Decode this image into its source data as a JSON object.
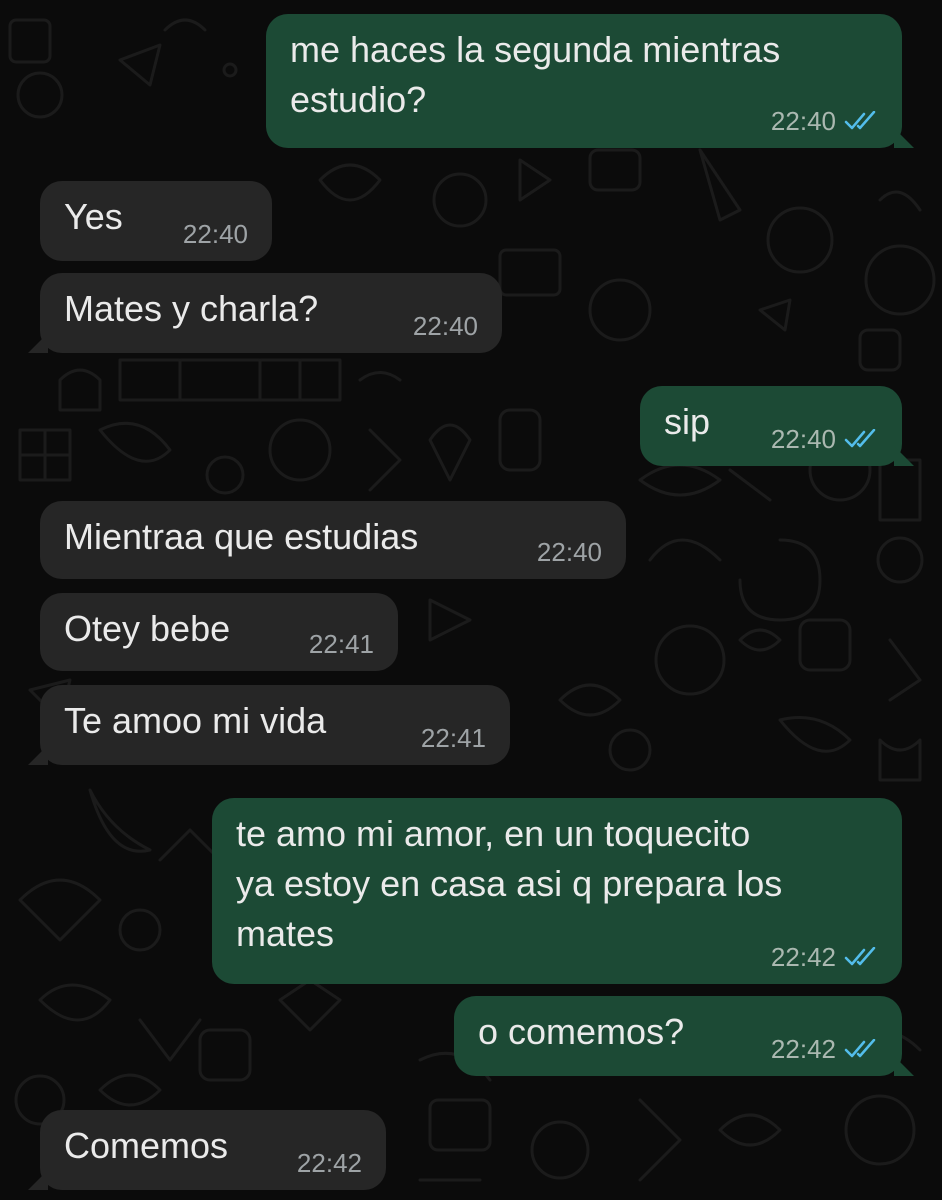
{
  "chat": {
    "background_pattern": "whatsapp-doodle-dark",
    "colors": {
      "incoming_bubble": "#262626",
      "outgoing_bubble": "#1c4a35",
      "read_ticks": "#53bdeb"
    },
    "messages": [
      {
        "direction": "out",
        "text": "me haces la segunda mientras\nestudio?",
        "time": "22:40",
        "status": "read"
      },
      {
        "direction": "in",
        "text": "Yes",
        "time": "22:40"
      },
      {
        "direction": "in",
        "text": "Mates y charla?",
        "time": "22:40"
      },
      {
        "direction": "out",
        "text": "sip",
        "time": "22:40",
        "status": "read"
      },
      {
        "direction": "in",
        "text": "Mientraa que estudias",
        "time": "22:40"
      },
      {
        "direction": "in",
        "text": "Otey bebe",
        "time": "22:41"
      },
      {
        "direction": "in",
        "text": "Te amoo mi vida",
        "time": "22:41"
      },
      {
        "direction": "out",
        "text": "te amo mi amor, en un toquecito\nya estoy en casa asi q prepara los\nmates",
        "time": "22:42",
        "status": "read"
      },
      {
        "direction": "out",
        "text": "o comemos?",
        "time": "22:42",
        "status": "read"
      },
      {
        "direction": "in",
        "text": "Comemos",
        "time": "22:42"
      }
    ]
  }
}
